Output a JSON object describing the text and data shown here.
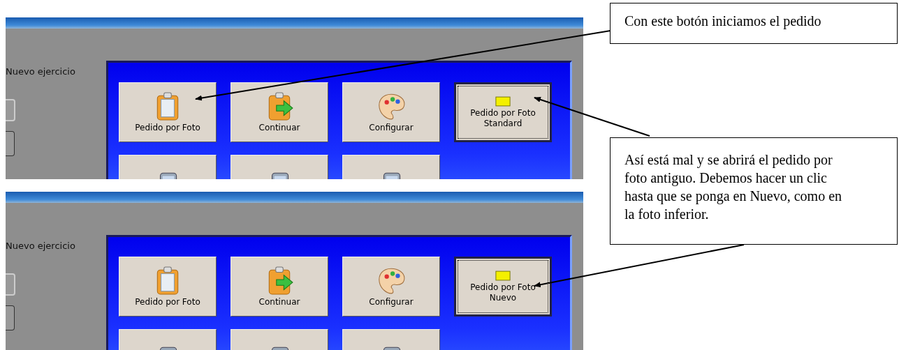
{
  "screenshots": [
    {
      "field_label": "Nuevo ejercicio",
      "buttons": [
        {
          "kind": "order",
          "label": "Pedido por Foto",
          "focused": false
        },
        {
          "kind": "continue",
          "label": "Continuar",
          "focused": false
        },
        {
          "kind": "settings",
          "label": "Configurar",
          "focused": false
        },
        {
          "kind": "mode",
          "label": "Pedido por Foto Standard",
          "focused": true
        },
        {
          "kind": "device-in",
          "focused": false
        },
        {
          "kind": "device-up",
          "focused": false
        },
        {
          "kind": "device-out",
          "focused": false
        }
      ]
    },
    {
      "field_label": "Nuevo ejercicio",
      "buttons": [
        {
          "kind": "order",
          "label": "Pedido por Foto",
          "focused": false
        },
        {
          "kind": "continue",
          "label": "Continuar",
          "focused": false
        },
        {
          "kind": "settings",
          "label": "Configurar",
          "focused": false
        },
        {
          "kind": "mode",
          "label": "Pedido por Foto Nuevo",
          "focused": true
        },
        {
          "kind": "device-in",
          "focused": false
        },
        {
          "kind": "device-up",
          "focused": false
        },
        {
          "kind": "device-out",
          "focused": false
        }
      ]
    }
  ],
  "callouts": [
    {
      "text": "Con este botón iniciamos el pedido"
    },
    {
      "text": "Así está mal y se abrirá el pedido por foto antiguo. Debemos hacer un clic hasta que se ponga en Nuevo, como en la foto inferior."
    }
  ]
}
